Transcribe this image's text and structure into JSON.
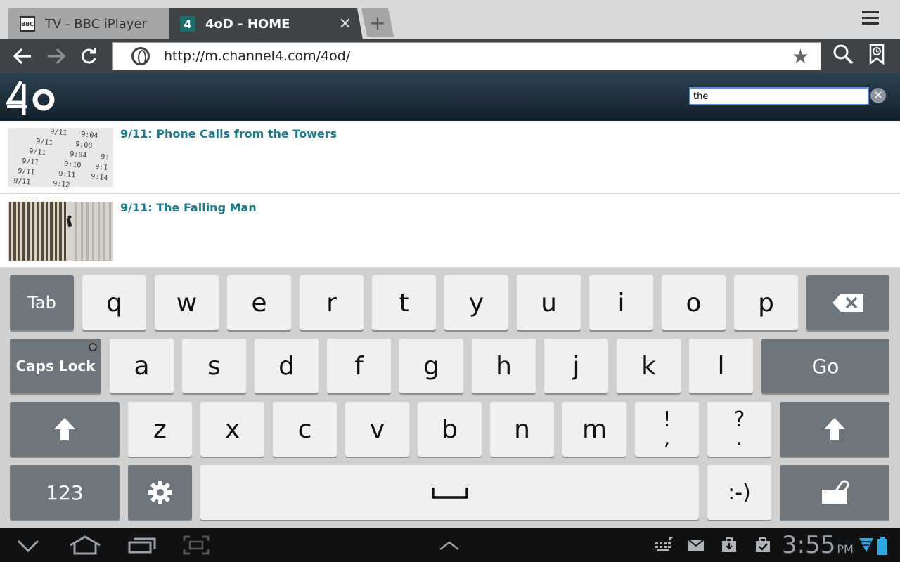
{
  "browser": {
    "tabs": [
      {
        "label": "TV - BBC iPlayer",
        "favicon": "BBC"
      },
      {
        "label": "4oD - HOME",
        "favicon": "4",
        "active": true
      }
    ],
    "url": "http://m.channel4.com/4od/"
  },
  "page": {
    "search_value": "the",
    "results": [
      {
        "title": "9/11: Phone Calls from the Towers"
      },
      {
        "title": "9/11: The Falling Man"
      }
    ]
  },
  "keyboard": {
    "row1": [
      "Tab",
      "q",
      "w",
      "e",
      "r",
      "t",
      "y",
      "u",
      "i",
      "o",
      "p"
    ],
    "row2": [
      "Caps Lock",
      "a",
      "s",
      "d",
      "f",
      "g",
      "h",
      "j",
      "k",
      "l",
      "Go"
    ],
    "row3": [
      "z",
      "x",
      "c",
      "v",
      "b",
      "n",
      "m"
    ],
    "row3_punct1_top": "!",
    "row3_punct1_bottom": ",",
    "row3_punct2_top": "?",
    "row3_punct2_bottom": ".",
    "row4": {
      "numbers": "123",
      "smiley": ":-)"
    }
  },
  "status": {
    "time": "3:55",
    "ampm": "PM"
  },
  "colors": {
    "link": "#1d7b8c",
    "header_bg": "#1f3340",
    "key_light": "#f0f0f0",
    "key_dark": "#6f767b",
    "wifi_icon": "#2ea6e0"
  }
}
